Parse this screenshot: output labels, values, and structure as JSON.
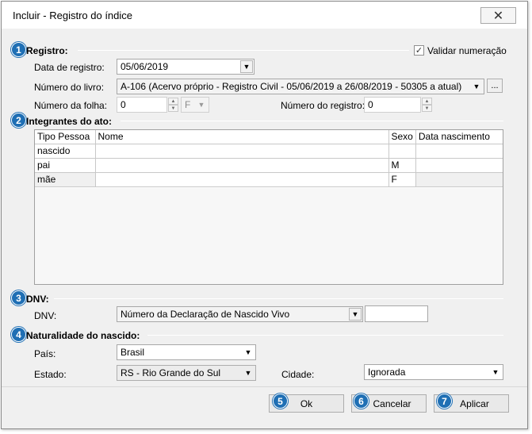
{
  "window": {
    "title": "Incluir - Registro do índice",
    "close_glyph": "✕"
  },
  "badges": {
    "b1": "1",
    "b2": "2",
    "b3": "3",
    "b4": "4",
    "b5": "5",
    "b6": "6",
    "b7": "7"
  },
  "registro": {
    "section_label": "Registro:",
    "validar_label": "Validar numeração",
    "validar_checked": true,
    "data_label": "Data de registro:",
    "data_value": "05/06/2019",
    "livro_label": "Número do livro:",
    "livro_value": "A-106 (Acervo próprio - Registro Civil - 05/06/2019 a 26/08/2019 - 50305 a atual)",
    "livro_browse": "...",
    "folha_label": "Número da folha:",
    "folha_value": "0",
    "folha_side": "F",
    "registro_label": "Número do registro:",
    "registro_value": "0"
  },
  "integrantes": {
    "section_label": "Integrantes do ato:",
    "columns": {
      "tipo": "Tipo Pessoa",
      "nome": "Nome",
      "sexo": "Sexo",
      "nasc": "Data nascimento"
    },
    "rows": [
      {
        "tipo": "nascido",
        "nome": "",
        "sexo": "",
        "nasc": ""
      },
      {
        "tipo": "pai",
        "nome": "",
        "sexo": "M",
        "nasc": ""
      },
      {
        "tipo": "mãe",
        "nome": "",
        "sexo": "F",
        "nasc": ""
      }
    ]
  },
  "dnv": {
    "section_label": "DNV:",
    "label": "DNV:",
    "type_value": "Número da Declaração de Nascido Vivo",
    "number_value": ""
  },
  "naturalidade": {
    "section_label": "Naturalidade do nascido:",
    "pais_label": "País:",
    "pais_value": "Brasil",
    "estado_label": "Estado:",
    "estado_value": "RS - Rio Grande do Sul",
    "cidade_label": "Cidade:",
    "cidade_value": "Ignorada"
  },
  "buttons": {
    "ok": "Ok",
    "cancelar": "Cancelar",
    "aplicar": "Aplicar"
  },
  "icons": {
    "dropdown": "▼",
    "spin_up": "▲",
    "spin_down": "▼",
    "check": "✓"
  },
  "colors": {
    "badge": "#1f6fb4",
    "window_bg": "#f0f0f0"
  }
}
